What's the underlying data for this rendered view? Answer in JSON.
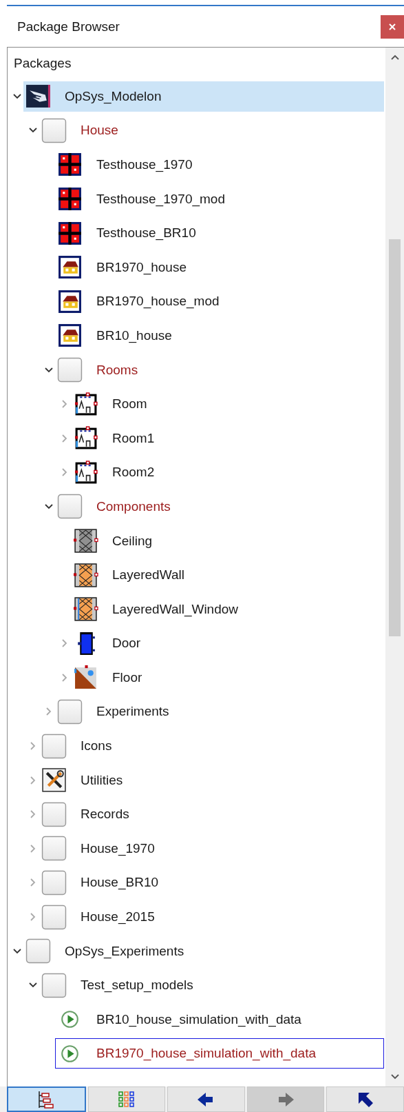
{
  "package_browser": {
    "title": "Package Browser",
    "tree_header": "Packages",
    "tree": [
      {
        "label": "OpSys_Modelon",
        "kind": "library",
        "color": "#1a1a1a",
        "selected": true,
        "focused": false,
        "expanded": true,
        "children": [
          {
            "label": "House",
            "kind": "package",
            "color": "#9b1b1b",
            "selected": false,
            "focused": false,
            "expanded": true,
            "children": [
              {
                "label": "Testhouse_1970",
                "kind": "testhouse",
                "color": "#1a1a1a",
                "selected": false,
                "focused": false
              },
              {
                "label": "Testhouse_1970_mod",
                "kind": "testhouse",
                "color": "#1a1a1a",
                "selected": false,
                "focused": false
              },
              {
                "label": "Testhouse_BR10",
                "kind": "testhouse",
                "color": "#1a1a1a",
                "selected": false,
                "focused": false
              },
              {
                "label": "BR1970_house",
                "kind": "house",
                "color": "#1a1a1a",
                "selected": false,
                "focused": false
              },
              {
                "label": "BR1970_house_mod",
                "kind": "house",
                "color": "#1a1a1a",
                "selected": false,
                "focused": false
              },
              {
                "label": "BR10_house",
                "kind": "house",
                "color": "#1a1a1a",
                "selected": false,
                "focused": false
              },
              {
                "label": "Rooms",
                "kind": "package",
                "color": "#9b1b1b",
                "selected": false,
                "focused": false,
                "expanded": true,
                "children": [
                  {
                    "label": "Room",
                    "kind": "room",
                    "color": "#1a1a1a",
                    "selected": false,
                    "focused": false,
                    "expanded": false
                  },
                  {
                    "label": "Room1",
                    "kind": "room",
                    "color": "#1a1a1a",
                    "selected": false,
                    "focused": false,
                    "expanded": false
                  },
                  {
                    "label": "Room2",
                    "kind": "room",
                    "color": "#1a1a1a",
                    "selected": false,
                    "focused": false,
                    "expanded": false
                  }
                ]
              },
              {
                "label": "Components",
                "kind": "package",
                "color": "#9b1b1b",
                "selected": false,
                "focused": false,
                "expanded": true,
                "children": [
                  {
                    "label": "Ceiling",
                    "kind": "ceiling",
                    "color": "#1a1a1a",
                    "selected": false,
                    "focused": false
                  },
                  {
                    "label": "LayeredWall",
                    "kind": "wall",
                    "color": "#1a1a1a",
                    "selected": false,
                    "focused": false
                  },
                  {
                    "label": "LayeredWall_Window",
                    "kind": "wall_window",
                    "color": "#1a1a1a",
                    "selected": false,
                    "focused": false
                  },
                  {
                    "label": "Door",
                    "kind": "door",
                    "color": "#1a1a1a",
                    "selected": false,
                    "focused": false,
                    "expanded": false
                  },
                  {
                    "label": "Floor",
                    "kind": "floor",
                    "color": "#1a1a1a",
                    "selected": false,
                    "focused": false,
                    "expanded": false
                  }
                ]
              },
              {
                "label": "Experiments",
                "kind": "package",
                "color": "#1a1a1a",
                "selected": false,
                "focused": false,
                "expanded": false
              }
            ]
          },
          {
            "label": "Icons",
            "kind": "package",
            "color": "#1a1a1a",
            "selected": false,
            "focused": false,
            "expanded": false
          },
          {
            "label": "Utilities",
            "kind": "tools",
            "color": "#1a1a1a",
            "selected": false,
            "focused": false,
            "expanded": false
          },
          {
            "label": "Records",
            "kind": "package",
            "color": "#1a1a1a",
            "selected": false,
            "focused": false,
            "expanded": false
          },
          {
            "label": "House_1970",
            "kind": "package",
            "color": "#1a1a1a",
            "selected": false,
            "focused": false,
            "expanded": false
          },
          {
            "label": "House_BR10",
            "kind": "package",
            "color": "#1a1a1a",
            "selected": false,
            "focused": false,
            "expanded": false
          },
          {
            "label": "House_2015",
            "kind": "package",
            "color": "#1a1a1a",
            "selected": false,
            "focused": false,
            "expanded": false
          }
        ]
      },
      {
        "label": "OpSys_Experiments",
        "kind": "package",
        "color": "#1a1a1a",
        "selected": false,
        "focused": false,
        "expanded": true,
        "children": [
          {
            "label": "Test_setup_models",
            "kind": "package",
            "color": "#1a1a1a",
            "selected": false,
            "focused": false,
            "expanded": true,
            "children": [
              {
                "label": "BR10_house_simulation_with_data",
                "kind": "experiment",
                "color": "#1a1a1a",
                "selected": false,
                "focused": false
              },
              {
                "label": "BR1970_house_simulation_with_data",
                "kind": "experiment",
                "color": "#9b1b1b",
                "selected": false,
                "focused": true
              }
            ]
          }
        ]
      }
    ],
    "toolbar": [
      {
        "kind": "tree",
        "selected": true,
        "disabled": false
      },
      {
        "kind": "grid",
        "selected": false,
        "disabled": false
      },
      {
        "kind": "back",
        "selected": false,
        "disabled": false
      },
      {
        "kind": "forward",
        "selected": false,
        "disabled": true
      },
      {
        "kind": "up",
        "selected": false,
        "disabled": false
      }
    ]
  }
}
